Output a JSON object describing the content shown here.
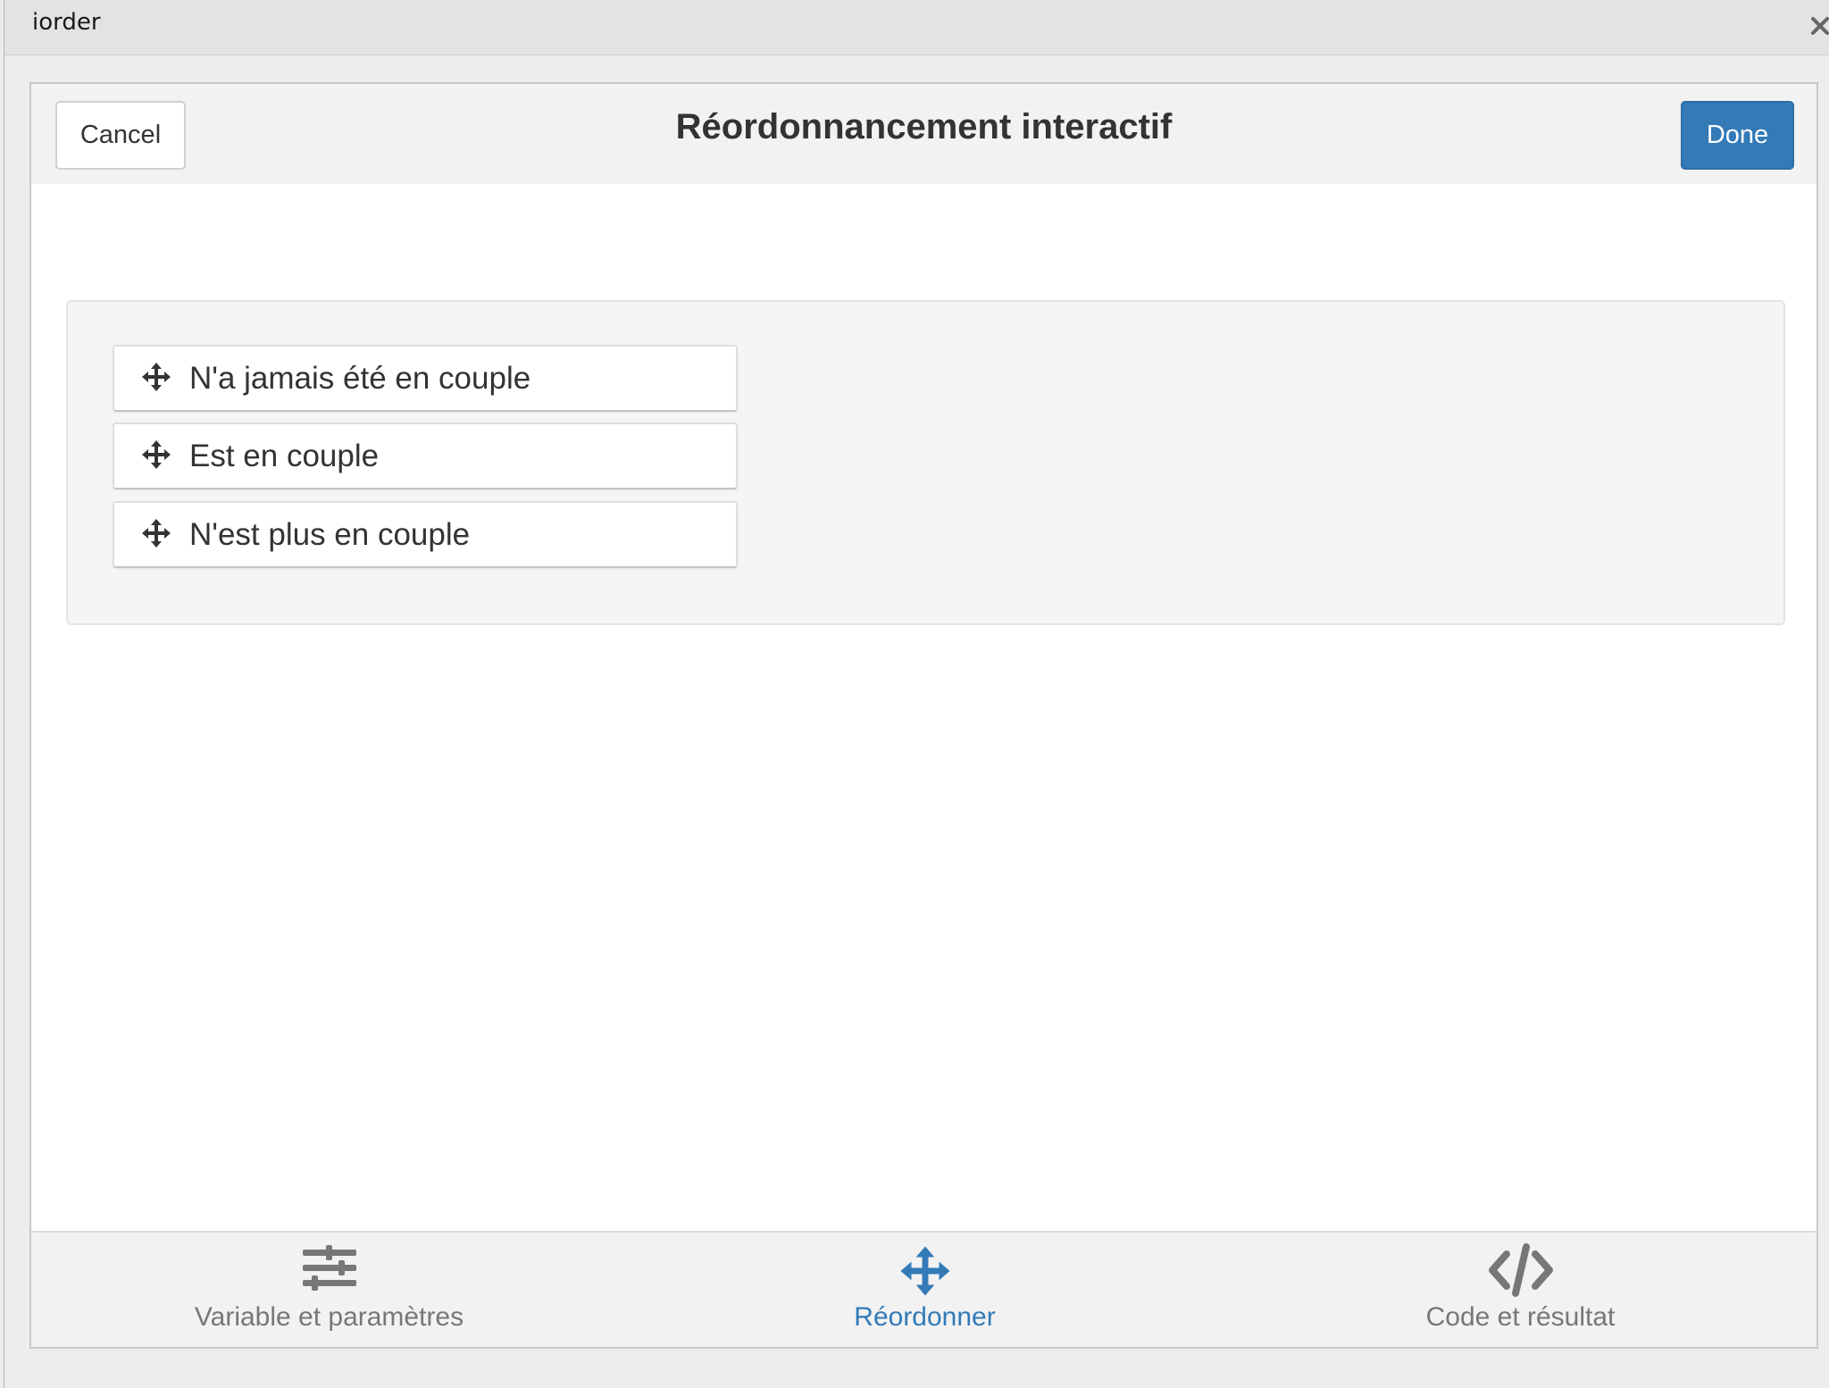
{
  "window": {
    "title": "iorder",
    "close_icon": "close-icon"
  },
  "header": {
    "cancel_label": "Cancel",
    "title": "Réordonnancement interactif",
    "done_label": "Done",
    "done_color": "#337ab7"
  },
  "sortable": {
    "item_icon": "move-icon",
    "items": [
      {
        "label": "N'a jamais été en couple"
      },
      {
        "label": "Est en couple"
      },
      {
        "label": "N'est plus en couple"
      }
    ]
  },
  "footer": {
    "active_color": "#337ab7",
    "inactive_color": "#777777",
    "tabs": [
      {
        "label": "Variable et paramètres",
        "icon": "sliders-icon",
        "active": false
      },
      {
        "label": "Réordonner",
        "icon": "move-arrows-icon",
        "active": true
      },
      {
        "label": "Code et résultat",
        "icon": "code-icon",
        "active": false
      }
    ]
  }
}
